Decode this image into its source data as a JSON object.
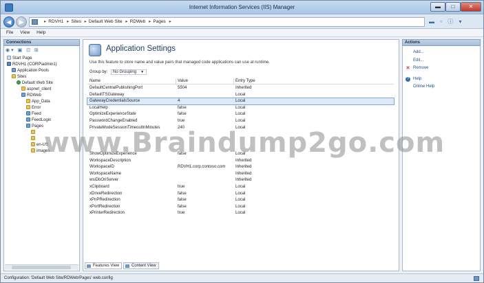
{
  "window": {
    "title": "Internet Information Services (IIS) Manager",
    "buttons": {
      "minimize": "▬",
      "maximize": "□",
      "close": "✕"
    }
  },
  "address": {
    "crumbs": [
      "RDVH1",
      "Sites",
      "Default Web Site",
      "RDWeb",
      "Pages"
    ],
    "tools": "▬ ▫ ⓘ ▾"
  },
  "menu": {
    "file": "File",
    "view": "View",
    "help": "Help"
  },
  "connections": {
    "header": "Connections",
    "toolbar": "◉▾ ▣ ⊡ ⊞",
    "tree": [
      {
        "label": "Start Page",
        "icon": "page",
        "indent": 0
      },
      {
        "label": "RDVH1 (CORP\\admin1)",
        "icon": "server",
        "indent": 0
      },
      {
        "label": "Application Pools",
        "icon": "app",
        "indent": 1
      },
      {
        "label": "Sites",
        "icon": "folder",
        "indent": 1
      },
      {
        "label": "Default Web Site",
        "icon": "globe",
        "indent": 2
      },
      {
        "label": "aspnet_client",
        "icon": "folder",
        "indent": 3
      },
      {
        "label": "RDWeb",
        "icon": "app",
        "indent": 3
      },
      {
        "label": "App_Data",
        "icon": "folder",
        "indent": 4
      },
      {
        "label": "Error",
        "icon": "folder",
        "indent": 4
      },
      {
        "label": "Feed",
        "icon": "app",
        "indent": 4
      },
      {
        "label": "FeedLogin",
        "icon": "app",
        "indent": 4
      },
      {
        "label": "Pages",
        "icon": "app",
        "indent": 4
      },
      {
        "label": "",
        "icon": "folder",
        "indent": 5
      },
      {
        "label": "",
        "icon": "folder",
        "indent": 5
      },
      {
        "label": "en-US",
        "icon": "folder",
        "indent": 5
      },
      {
        "label": "images",
        "icon": "folder",
        "indent": 5
      }
    ]
  },
  "feature": {
    "title": "Application Settings",
    "description": "Use this feature to store name and value pairs that managed code applications can use at runtime.",
    "group_by_label": "Group by:",
    "group_by_value": "No Grouping",
    "columns": {
      "name": "Name",
      "value": "Value",
      "entry_type": "Entry Type"
    },
    "rows": [
      {
        "name": "DefaultCentralPublishingPort",
        "value": "5504",
        "type": "Inherited"
      },
      {
        "name": "DefaultTSGateway",
        "value": "",
        "type": "Local"
      },
      {
        "name": "GatewayCredentialsSource",
        "value": "4",
        "type": "Local"
      },
      {
        "name": "LocalHelp",
        "value": "false",
        "type": "Local"
      },
      {
        "name": "OptimizeExperienceState",
        "value": "false",
        "type": "Local"
      },
      {
        "name": "PasswordChangeEnabled",
        "value": "true",
        "type": "Local"
      },
      {
        "name": "PrivateModeSessionTimeoutInMinutes",
        "value": "240",
        "type": "Local"
      },
      {
        "name": "",
        "value": "",
        "type": ""
      },
      {
        "name": "",
        "value": "",
        "type": ""
      },
      {
        "name": "",
        "value": "",
        "type": ""
      },
      {
        "name": "ShowOptimizeExperience",
        "value": "false",
        "type": "Local"
      },
      {
        "name": "WorkspaceDescription",
        "value": "",
        "type": "Inherited"
      },
      {
        "name": "WorkspaceID",
        "value": "RDVH1.corp.contoso.com",
        "type": "Inherited"
      },
      {
        "name": "WorkspaceName",
        "value": "",
        "type": "Inherited"
      },
      {
        "name": "wsiDbOnServer",
        "value": "",
        "type": "Inherited"
      },
      {
        "name": "xClipboard",
        "value": "true",
        "type": "Local"
      },
      {
        "name": "xDriveRedirection",
        "value": "false",
        "type": "Local"
      },
      {
        "name": "xPnPRedirection",
        "value": "false",
        "type": "Local"
      },
      {
        "name": "xPortRedirection",
        "value": "false",
        "type": "Local"
      },
      {
        "name": "xPrinterRedirection",
        "value": "true",
        "type": "Local"
      }
    ],
    "selected_index": 2,
    "tabs": {
      "features": "Features View",
      "content": "Content View"
    }
  },
  "actions": {
    "header": "Actions",
    "add": "Add...",
    "edit": "Edit...",
    "remove": "Remove",
    "help": "Help",
    "online_help": "Online Help"
  },
  "status": {
    "text": "Configuration: 'Default Web Site/RDWeb/Pages' web.config"
  },
  "watermark": "www.Braindump2go.com"
}
